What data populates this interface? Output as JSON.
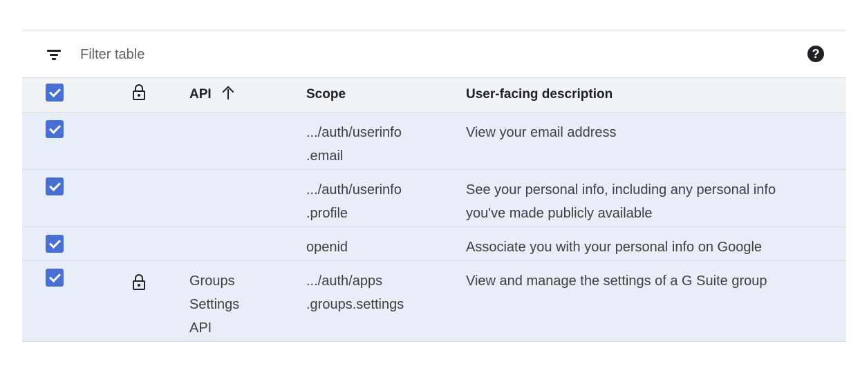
{
  "filter": {
    "placeholder": "Filter table"
  },
  "header": {
    "api_label": "API",
    "scope_label": "Scope",
    "description_label": "User-facing description"
  },
  "rows": [
    {
      "checked": true,
      "api": "",
      "scope_line1": ".../auth/userinfo",
      "scope_line2": ".email",
      "description_line1": "View your email address",
      "description_line2": ""
    },
    {
      "checked": true,
      "api": "",
      "scope_line1": ".../auth/userinfo",
      "scope_line2": ".profile",
      "description_line1": "See your personal info, including any personal info",
      "description_line2": "you've made publicly available"
    },
    {
      "checked": true,
      "api": "",
      "scope_line1": "openid",
      "scope_line2": "",
      "description_line1": "Associate you with your personal info on Google",
      "description_line2": ""
    },
    {
      "checked": true,
      "api_line1": "Groups",
      "api_line2": "Settings",
      "api_line3": "API",
      "scope_line1": ".../auth/apps",
      "scope_line2": ".groups.settings",
      "description_line1": "View and manage the settings of a G Suite group",
      "description_line2": ""
    }
  ],
  "icons": {
    "filter": "filter-list-icon",
    "help": "help-icon",
    "lock": "lock-icon",
    "sort": "arrow-upward-icon"
  },
  "colors": {
    "checkbox": "#4a6fd3",
    "row_selected": "#e8eef8",
    "header_bg": "#f1f3f4"
  }
}
